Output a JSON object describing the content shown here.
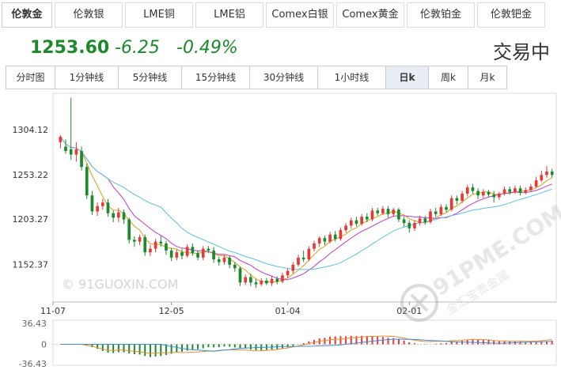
{
  "tabs": [
    {
      "label": "伦敦金",
      "active": true
    },
    {
      "label": "伦敦银",
      "active": false
    },
    {
      "label": "LME铜",
      "active": false
    },
    {
      "label": "LME铝",
      "active": false
    },
    {
      "label": "Comex白银",
      "active": false
    },
    {
      "label": "Comex黄金",
      "active": false
    },
    {
      "label": "伦敦铂金",
      "active": false
    },
    {
      "label": "伦敦钯金",
      "active": false
    }
  ],
  "quote": {
    "price": "1253.60",
    "change": "-6.25",
    "change_pct": "-0.49%",
    "status": "交易中",
    "color": "#1a8a2a"
  },
  "periods": [
    {
      "label": "分时图",
      "active": false
    },
    {
      "label": "1分钟线",
      "active": false
    },
    {
      "label": "5分钟线",
      "active": false
    },
    {
      "label": "15分钟线",
      "active": false
    },
    {
      "label": "30分钟线",
      "active": false
    },
    {
      "label": "1小时线",
      "active": false
    },
    {
      "label": "日k",
      "active": true
    },
    {
      "label": "周k",
      "active": false
    },
    {
      "label": "月k",
      "active": false
    }
  ],
  "watermarks": {
    "chart": "© 91GUOXIN.COM",
    "logo": "91PME.COM",
    "logo_sub": "金汇宝贵金属"
  },
  "colors": {
    "up": "#e53935",
    "down": "#1a8a2a",
    "ma1": "#d4a017",
    "ma2": "#c13cc7",
    "ma3": "#5bc0de"
  },
  "chart_data": {
    "type": "candlestick",
    "y_ticks": [
      "1304.12",
      "1253.22",
      "1203.27",
      "1152.37"
    ],
    "x_ticks": [
      "11-07",
      "12-05",
      "01-04",
      "02-01"
    ],
    "ylim": [
      1110,
      1345
    ],
    "candles": [
      [
        1290,
        1296,
        1283,
        1298
      ],
      [
        1285,
        1280,
        1277,
        1293
      ],
      [
        1282,
        1276,
        1270,
        1340
      ],
      [
        1276,
        1282,
        1268,
        1290
      ],
      [
        1280,
        1262,
        1258,
        1285
      ],
      [
        1262,
        1230,
        1226,
        1266
      ],
      [
        1230,
        1212,
        1208,
        1235
      ],
      [
        1212,
        1218,
        1207,
        1222
      ],
      [
        1218,
        1222,
        1214,
        1226
      ],
      [
        1222,
        1210,
        1206,
        1226
      ],
      [
        1210,
        1205,
        1200,
        1213
      ],
      [
        1205,
        1211,
        1200,
        1216
      ],
      [
        1211,
        1203,
        1198,
        1214
      ],
      [
        1203,
        1180,
        1176,
        1205
      ],
      [
        1180,
        1178,
        1172,
        1184
      ],
      [
        1178,
        1183,
        1174,
        1186
      ],
      [
        1183,
        1166,
        1162,
        1186
      ],
      [
        1166,
        1170,
        1162,
        1174
      ],
      [
        1170,
        1178,
        1166,
        1181
      ],
      [
        1178,
        1176,
        1172,
        1185
      ],
      [
        1176,
        1168,
        1163,
        1179
      ],
      [
        1168,
        1160,
        1156,
        1171
      ],
      [
        1160,
        1166,
        1157,
        1169
      ],
      [
        1166,
        1162,
        1158,
        1170
      ],
      [
        1162,
        1172,
        1160,
        1175
      ],
      [
        1172,
        1165,
        1162,
        1176
      ],
      [
        1165,
        1160,
        1157,
        1168
      ],
      [
        1160,
        1170,
        1157,
        1173
      ],
      [
        1170,
        1168,
        1165,
        1173
      ],
      [
        1168,
        1158,
        1154,
        1172
      ],
      [
        1158,
        1155,
        1151,
        1161
      ],
      [
        1155,
        1160,
        1152,
        1163
      ],
      [
        1160,
        1152,
        1148,
        1162
      ],
      [
        1152,
        1148,
        1144,
        1155
      ],
      [
        1148,
        1132,
        1128,
        1150
      ],
      [
        1132,
        1138,
        1129,
        1141
      ],
      [
        1138,
        1132,
        1128,
        1142
      ],
      [
        1132,
        1130,
        1126,
        1136
      ],
      [
        1130,
        1134,
        1128,
        1137
      ],
      [
        1134,
        1131,
        1129,
        1137
      ],
      [
        1131,
        1136,
        1128,
        1139
      ],
      [
        1136,
        1133,
        1130,
        1139
      ],
      [
        1133,
        1140,
        1131,
        1143
      ],
      [
        1140,
        1145,
        1137,
        1148
      ],
      [
        1145,
        1152,
        1142,
        1155
      ],
      [
        1152,
        1160,
        1150,
        1163
      ],
      [
        1160,
        1158,
        1155,
        1168
      ],
      [
        1158,
        1170,
        1156,
        1173
      ],
      [
        1170,
        1176,
        1167,
        1179
      ],
      [
        1176,
        1182,
        1172,
        1184
      ],
      [
        1182,
        1178,
        1174,
        1185
      ],
      [
        1178,
        1186,
        1176,
        1189
      ],
      [
        1186,
        1181,
        1178,
        1190
      ],
      [
        1181,
        1191,
        1179,
        1194
      ],
      [
        1191,
        1196,
        1188,
        1199
      ],
      [
        1196,
        1202,
        1193,
        1205
      ],
      [
        1202,
        1198,
        1195,
        1206
      ],
      [
        1198,
        1206,
        1196,
        1209
      ],
      [
        1206,
        1203,
        1200,
        1210
      ],
      [
        1203,
        1213,
        1201,
        1216
      ],
      [
        1213,
        1210,
        1207,
        1216
      ],
      [
        1210,
        1215,
        1208,
        1218
      ],
      [
        1215,
        1209,
        1205,
        1218
      ],
      [
        1209,
        1214,
        1206,
        1216
      ],
      [
        1214,
        1203,
        1200,
        1216
      ],
      [
        1203,
        1199,
        1195,
        1206
      ],
      [
        1199,
        1193,
        1188,
        1202
      ],
      [
        1193,
        1199,
        1190,
        1202
      ],
      [
        1199,
        1204,
        1196,
        1207
      ],
      [
        1204,
        1200,
        1197,
        1207
      ],
      [
        1200,
        1212,
        1198,
        1215
      ],
      [
        1212,
        1209,
        1206,
        1216
      ],
      [
        1209,
        1217,
        1207,
        1220
      ],
      [
        1217,
        1214,
        1211,
        1220
      ],
      [
        1214,
        1227,
        1212,
        1230
      ],
      [
        1227,
        1224,
        1220,
        1230
      ],
      [
        1224,
        1232,
        1221,
        1235
      ],
      [
        1232,
        1239,
        1229,
        1242
      ],
      [
        1239,
        1235,
        1232,
        1243
      ],
      [
        1235,
        1230,
        1226,
        1238
      ],
      [
        1230,
        1234,
        1227,
        1237
      ],
      [
        1234,
        1231,
        1228,
        1236
      ],
      [
        1231,
        1228,
        1222,
        1235
      ],
      [
        1228,
        1232,
        1225,
        1234
      ],
      [
        1232,
        1237,
        1230,
        1240
      ],
      [
        1237,
        1234,
        1231,
        1240
      ],
      [
        1234,
        1238,
        1232,
        1241
      ],
      [
        1238,
        1233,
        1230,
        1241
      ],
      [
        1233,
        1236,
        1231,
        1239
      ],
      [
        1236,
        1240,
        1234,
        1243
      ],
      [
        1240,
        1247,
        1238,
        1251
      ],
      [
        1247,
        1253,
        1245,
        1258
      ],
      [
        1253,
        1257,
        1250,
        1263
      ],
      [
        1257,
        1253,
        1250,
        1260
      ]
    ]
  }
}
